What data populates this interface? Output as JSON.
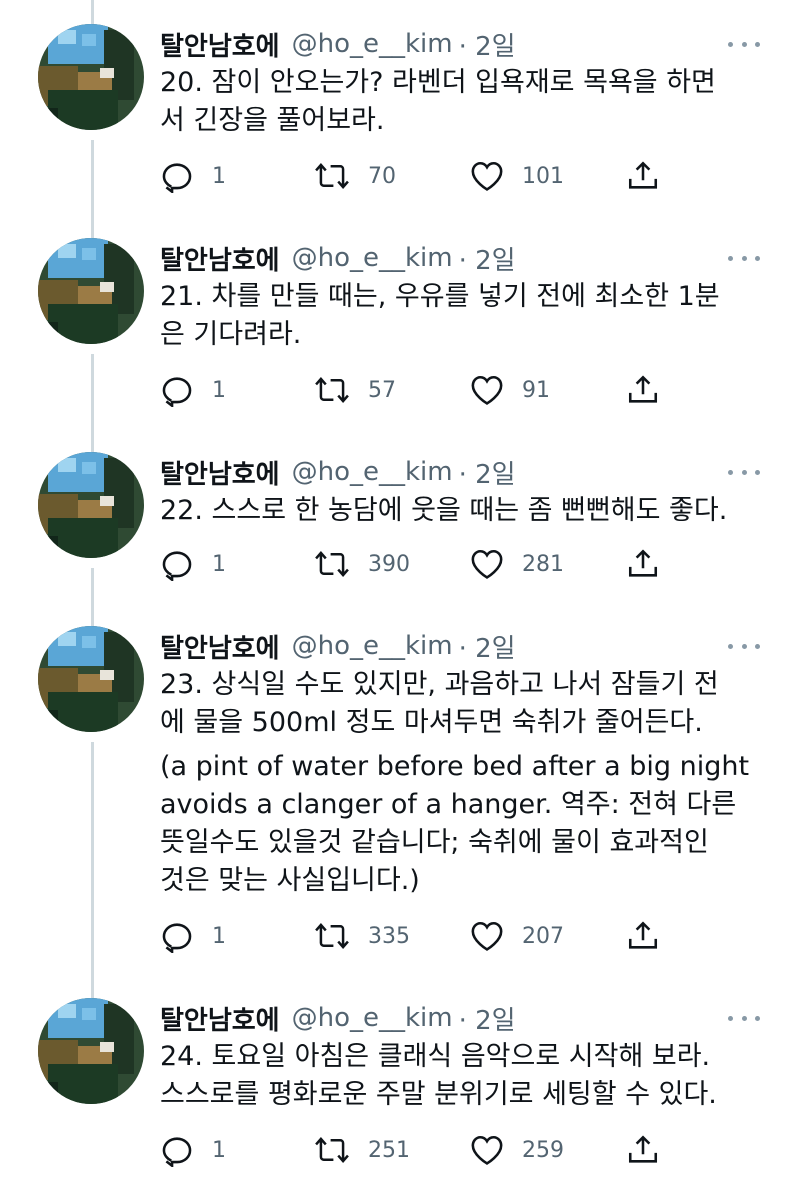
{
  "author": {
    "name": "탈안남호에",
    "handle": "@ho_e__kim",
    "time": "· 2일"
  },
  "tweets": [
    {
      "lines": [
        "20. 잠이 안오는가? 라벤더 입욕재로 목욕을 하면",
        "서 긴장을 풀어보라."
      ],
      "replies": "1",
      "retweets": "70",
      "likes": "101"
    },
    {
      "lines": [
        "21. 차를 만들 때는, 우유를 넣기 전에 최소한 1분",
        "은 기다려라."
      ],
      "replies": "1",
      "retweets": "57",
      "likes": "91"
    },
    {
      "lines": [
        "22. 스스로 한 농담에 웃을 때는 좀 뻔뻔해도 좋다."
      ],
      "replies": "1",
      "retweets": "390",
      "likes": "281"
    },
    {
      "lines": [
        "23. 상식일 수도 있지만, 과음하고 나서 잠들기 전",
        "에 물을 500ml 정도 마셔두면 숙취가 줄어든다."
      ],
      "lines2": [
        "(a pint of water before bed after a big night",
        "avoids a clanger of a hanger. 역주: 전혀 다른",
        "뜻일수도 있을것 같습니다; 숙취에 물이 효과적인",
        "것은 맞는 사실입니다.)"
      ],
      "replies": "1",
      "retweets": "335",
      "likes": "207"
    },
    {
      "lines": [
        "24. 토요일 아침은 클래식 음악으로 시작해 보라.",
        "스스로를 평화로운 주말 분위기로 세팅할 수 있다."
      ],
      "replies": "1",
      "retweets": "251",
      "likes": "259"
    }
  ],
  "icons": {
    "reply": "reply-icon",
    "retweet": "retweet-icon",
    "like": "heart-icon",
    "share": "share-icon",
    "more": "more-icon"
  },
  "colors": {
    "text": "#0f1419",
    "secondary": "#536471",
    "thread": "#cfd9de"
  }
}
